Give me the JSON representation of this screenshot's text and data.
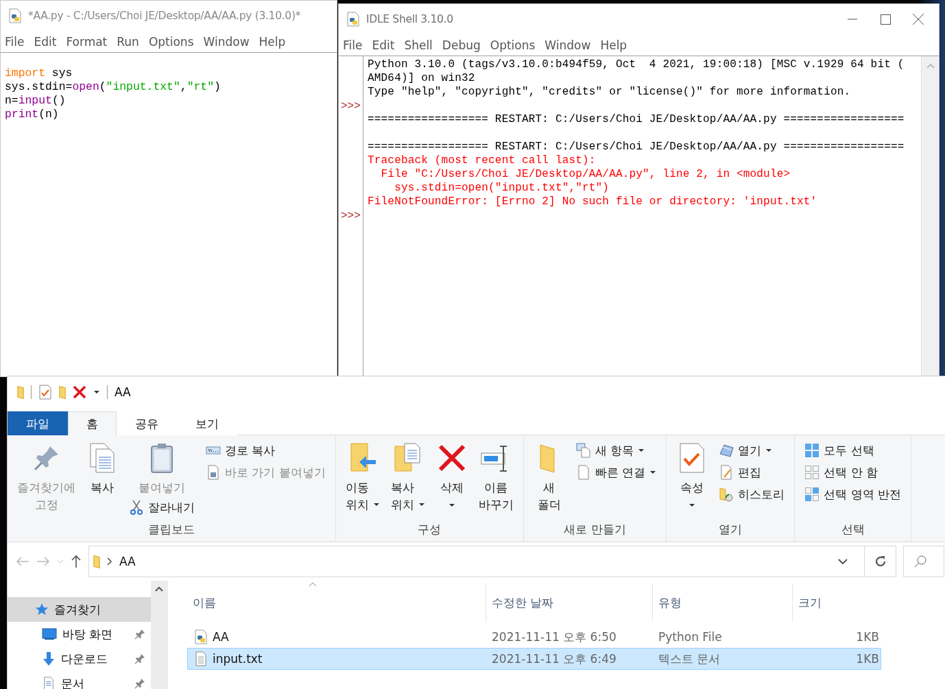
{
  "editor": {
    "title": "*AA.py - C:/Users/Choi JE/Desktop/AA/AA.py (3.10.0)*",
    "menu": [
      "File",
      "Edit",
      "Format",
      "Run",
      "Options",
      "Window",
      "Help"
    ],
    "code": [
      [
        {
          "kind": "keyword",
          "text": "import"
        },
        {
          "kind": "plain",
          "text": " sys"
        }
      ],
      [
        {
          "kind": "plain",
          "text": "sys.stdin="
        },
        {
          "kind": "builtin",
          "text": "open"
        },
        {
          "kind": "plain",
          "text": "("
        },
        {
          "kind": "string",
          "text": "\"input.txt\""
        },
        {
          "kind": "plain",
          "text": ","
        },
        {
          "kind": "string",
          "text": "\"rt\""
        },
        {
          "kind": "plain",
          "text": ")"
        }
      ],
      [
        {
          "kind": "plain",
          "text": "n="
        },
        {
          "kind": "builtin",
          "text": "input"
        },
        {
          "kind": "plain",
          "text": "()"
        }
      ],
      [
        {
          "kind": "builtin",
          "text": "print"
        },
        {
          "kind": "plain",
          "text": "(n)"
        }
      ]
    ]
  },
  "shell": {
    "title": "IDLE Shell 3.10.0",
    "menu": [
      "File",
      "Edit",
      "Shell",
      "Debug",
      "Options",
      "Window",
      "Help"
    ],
    "lines": [
      {
        "kind": "output",
        "text": "Python 3.10.0 (tags/v3.10.0:b494f59, Oct  4 2021, 19:00:18) [MSC v.1929 64 bit ("
      },
      {
        "kind": "output",
        "text": "AMD64)] on win32"
      },
      {
        "kind": "output",
        "text": "Type \"help\", \"copyright\", \"credits\" or \"license()\" for more information."
      },
      {
        "kind": "blank",
        "prompt": ">>>"
      },
      {
        "kind": "output",
        "text": "================== RESTART: C:/Users/Choi JE/Desktop/AA/AA.py =================="
      },
      {
        "kind": "blank"
      },
      {
        "kind": "output",
        "text": "================== RESTART: C:/Users/Choi JE/Desktop/AA/AA.py =================="
      },
      {
        "kind": "error",
        "text": "Traceback (most recent call last):"
      },
      {
        "kind": "error",
        "text": "  File \"C:/Users/Choi JE/Desktop/AA/AA.py\", line 2, in <module>"
      },
      {
        "kind": "error",
        "text": "    sys.stdin=open(\"input.txt\",\"rt\")"
      },
      {
        "kind": "error",
        "text": "FileNotFoundError: [Errno 2] No such file or directory: 'input.txt'"
      },
      {
        "kind": "blank",
        "prompt": ">>>"
      }
    ]
  },
  "explorer": {
    "title": "AA",
    "tabs": [
      {
        "label": "파일",
        "kind": "file",
        "selected": false
      },
      {
        "label": "홈",
        "kind": "tab",
        "selected": true
      },
      {
        "label": "공유",
        "kind": "tab",
        "selected": false
      },
      {
        "label": "보기",
        "kind": "tab",
        "selected": false
      }
    ],
    "ribbon": [
      {
        "label": "클립보드",
        "columns": [
          [
            {
              "kind": "large",
              "label": "즐겨찾기에\n고정",
              "disabled": true
            }
          ],
          [
            {
              "kind": "large",
              "label": "복사",
              "disabled": false
            }
          ],
          [
            {
              "kind": "large",
              "label": "붙여넣기",
              "disabled": true
            },
            {
              "kind": "small",
              "label": "잘라내기",
              "disabled": false
            }
          ],
          [
            {
              "kind": "small",
              "label": "경로 복사",
              "disabled": false
            },
            {
              "kind": "small",
              "label": "바로 가기 붙여넣기",
              "disabled": true
            }
          ]
        ]
      },
      {
        "label": "구성",
        "columns": [
          [
            {
              "kind": "large",
              "label": "이동\n위치",
              "dropdown": true
            }
          ],
          [
            {
              "kind": "large",
              "label": "복사\n위치",
              "dropdown": true
            }
          ],
          [
            {
              "kind": "large",
              "label": "삭제",
              "dropdown": true
            }
          ],
          [
            {
              "kind": "large",
              "label": "이름\n바꾸기"
            }
          ]
        ]
      },
      {
        "label": "새로 만들기",
        "columns": [
          [
            {
              "kind": "large",
              "label": "새\n폴더"
            }
          ],
          [
            {
              "kind": "small",
              "label": "새 항목",
              "dropdown": true
            },
            {
              "kind": "small",
              "label": "빠른 연결",
              "dropdown": true
            }
          ]
        ]
      },
      {
        "label": "열기",
        "columns": [
          [
            {
              "kind": "large",
              "label": "속성",
              "dropdown": true
            }
          ],
          [
            {
              "kind": "small",
              "label": "열기",
              "dropdown": true
            },
            {
              "kind": "small",
              "label": "편집"
            },
            {
              "kind": "small",
              "label": "히스토리"
            }
          ]
        ]
      },
      {
        "label": "선택",
        "columns": [
          [
            {
              "kind": "small",
              "label": "모두 선택"
            },
            {
              "kind": "small",
              "label": "선택 안 함"
            },
            {
              "kind": "small",
              "label": "선택 영역 반전"
            }
          ]
        ]
      }
    ],
    "address": [
      "AA"
    ],
    "nav": [
      {
        "label": "즐겨찾기",
        "kind": "group",
        "selected": true
      },
      {
        "label": "바탕 화면",
        "kind": "desktop",
        "pinned": true,
        "selected": false
      },
      {
        "label": "다운로드",
        "kind": "download",
        "pinned": true,
        "selected": false
      },
      {
        "label": "문서",
        "kind": "document",
        "pinned": true,
        "selected": false
      }
    ],
    "columns": [
      "이름",
      "수정한 날짜",
      "유형",
      "크기"
    ],
    "files": [
      {
        "name": "AA",
        "date": "2021-11-11 오후 6:50",
        "type": "Python File",
        "size": "1KB",
        "kind": "python",
        "selected": false
      },
      {
        "name": "input.txt",
        "date": "2021-11-11 오후 6:49",
        "type": "텍스트 문서",
        "size": "1KB",
        "kind": "text",
        "selected": true
      }
    ]
  }
}
